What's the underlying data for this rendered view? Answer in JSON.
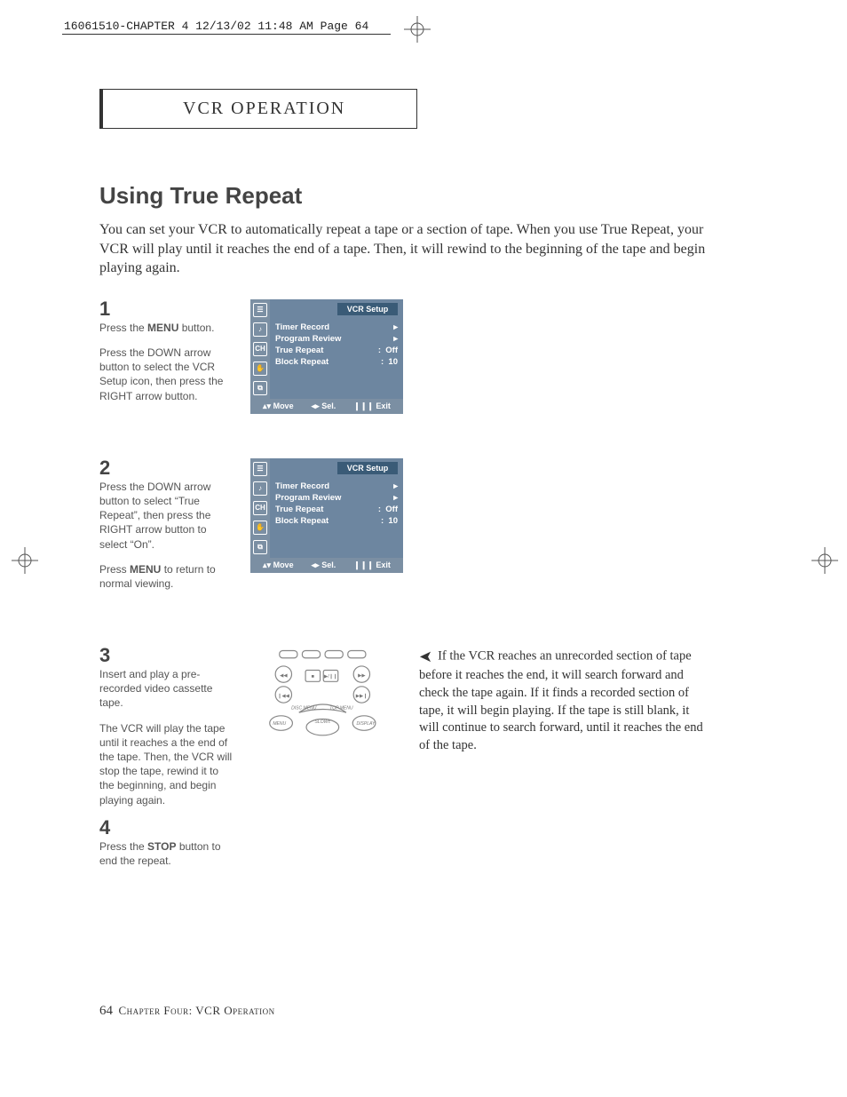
{
  "runhead": "16061510-CHAPTER 4  12/13/02 11:48 AM  Page 64",
  "chapter_label": "VCR OPERATION",
  "title": "Using True Repeat",
  "intro": "You can set your VCR to automatically repeat a tape or a section of tape. When you use True Repeat, your VCR will play until it reaches the end of a tape. Then, it will rewind to the beginning of the tape and begin playing again.",
  "steps": {
    "s1": {
      "num": "1",
      "p1a": "Press the ",
      "p1b": "MENU",
      "p1c": " button.",
      "p2": "Press the DOWN arrow button to select the VCR Setup icon, then press the RIGHT arrow button."
    },
    "s2": {
      "num": "2",
      "p1": "Press the DOWN arrow button to select “True Repeat”, then press the RIGHT arrow  button to select “On”.",
      "p2a": "Press ",
      "p2b": "MENU",
      "p2c": " to return to normal viewing."
    },
    "s3": {
      "num": "3",
      "p1": "Insert and play a pre-recorded video cassette tape.",
      "p2": "The VCR will play the tape until it reaches a the end of the tape. Then, the VCR will stop the tape, rewind it to the beginning, and begin playing again."
    },
    "s4": {
      "num": "4",
      "p1a": "Press the ",
      "p1b": "STOP",
      "p1c": " button to end the repeat."
    }
  },
  "osd": {
    "title": "VCR Setup",
    "rows": {
      "r1": {
        "label": "Timer Record",
        "val": "▸"
      },
      "r2": {
        "label": "Program Review",
        "val": "▸"
      },
      "r3": {
        "label": "True Repeat",
        "sep": ":",
        "val": "Off"
      },
      "r4": {
        "label": "Block Repeat",
        "sep": ":",
        "val": "10"
      }
    },
    "foot": {
      "move": "▴▾ Move",
      "sel": "◂▸ Sel.",
      "exit": "❙❙❙ Exit"
    },
    "icons": {
      "i1": "☰",
      "i2": "♪",
      "i3": "CH",
      "i4": "✋",
      "i5": "⧉"
    }
  },
  "remote_labels": {
    "disc": "DISC MENU",
    "top": "TOP MENU",
    "menu": "MENU",
    "slow": "SLOW±",
    "disp": "DISPLAY",
    "play": "▶/❙❙",
    "stop": "■",
    "rew": "◀◀",
    "ff": "▶▶",
    "prev": "❙◀◀",
    "next": "▶▶❙"
  },
  "note": "If the VCR reaches an unrecorded section of tape before it reaches the end, it will search forward and check the tape again. If it finds a recorded section of tape, it will begin playing. If the tape is still blank, it will continue to search forward, until it reaches the end of the tape.",
  "footer": {
    "pagenum": "64",
    "chap": "Chapter Four: VCR Operation"
  }
}
